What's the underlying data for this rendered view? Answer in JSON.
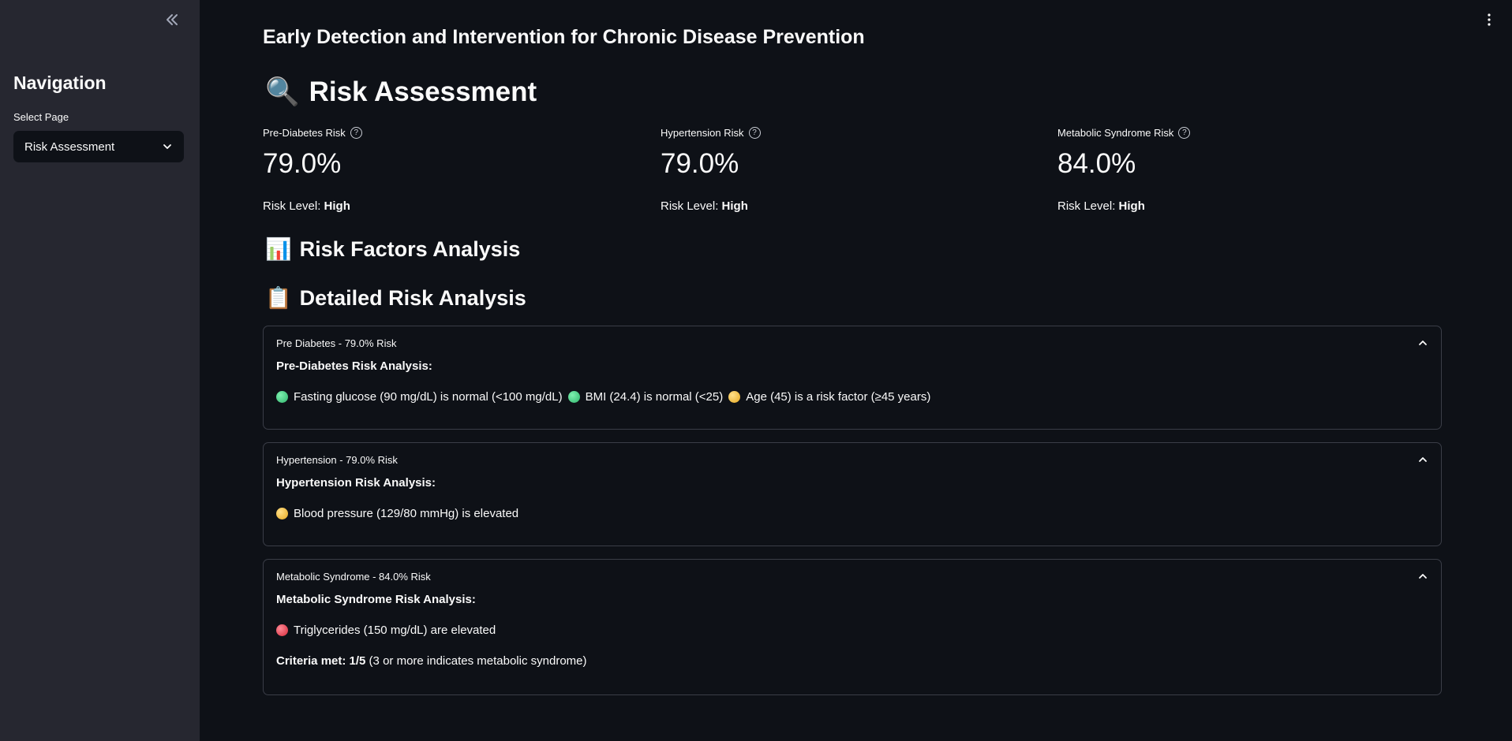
{
  "app": {
    "title": "Early Detection and Intervention for Chronic Disease Prevention"
  },
  "sidebar": {
    "collapse_icon": "double-chevron-left-icon",
    "nav_title": "Navigation",
    "select_label": "Select Page",
    "selected_page": "Risk Assessment"
  },
  "header": {
    "section_title": "Risk Assessment",
    "section_icon": "🔍"
  },
  "metrics": [
    {
      "label": "Pre-Diabetes Risk",
      "value": "79.0%",
      "level_prefix": "Risk Level: ",
      "level": "High"
    },
    {
      "label": "Hypertension Risk",
      "value": "79.0%",
      "level_prefix": "Risk Level: ",
      "level": "High"
    },
    {
      "label": "Metabolic Syndrome Risk",
      "value": "84.0%",
      "level_prefix": "Risk Level: ",
      "level": "High"
    }
  ],
  "sections": {
    "risk_factors": {
      "icon": "📊",
      "title": "Risk Factors Analysis"
    },
    "detailed": {
      "icon": "📋",
      "title": "Detailed Risk Analysis"
    }
  },
  "expanders": [
    {
      "header": "Pre Diabetes - 79.0% Risk",
      "subtitle": "Pre-Diabetes Risk Analysis:",
      "items": [
        {
          "color": "#3ec77b",
          "text": "Fasting glucose (90 mg/dL) is normal (<100 mg/dL)"
        },
        {
          "color": "#3ec77b",
          "text": "BMI (24.4) is normal (<25)"
        },
        {
          "color": "#f0b730",
          "text": "Age (45) is a risk factor (≥45 years)"
        }
      ]
    },
    {
      "header": "Hypertension - 79.0% Risk",
      "subtitle": "Hypertension Risk Analysis:",
      "items": [
        {
          "color": "#f0b730",
          "text": "Blood pressure (129/80 mmHg) is elevated"
        }
      ]
    },
    {
      "header": "Metabolic Syndrome - 84.0% Risk",
      "subtitle": "Metabolic Syndrome Risk Analysis:",
      "items": [
        {
          "color": "#e23347",
          "text": "Triglycerides (150 mg/dL) are elevated"
        }
      ],
      "criteria_label": "Criteria met: 1/5",
      "criteria_note": " (3 or more indicates metabolic syndrome)"
    }
  ]
}
